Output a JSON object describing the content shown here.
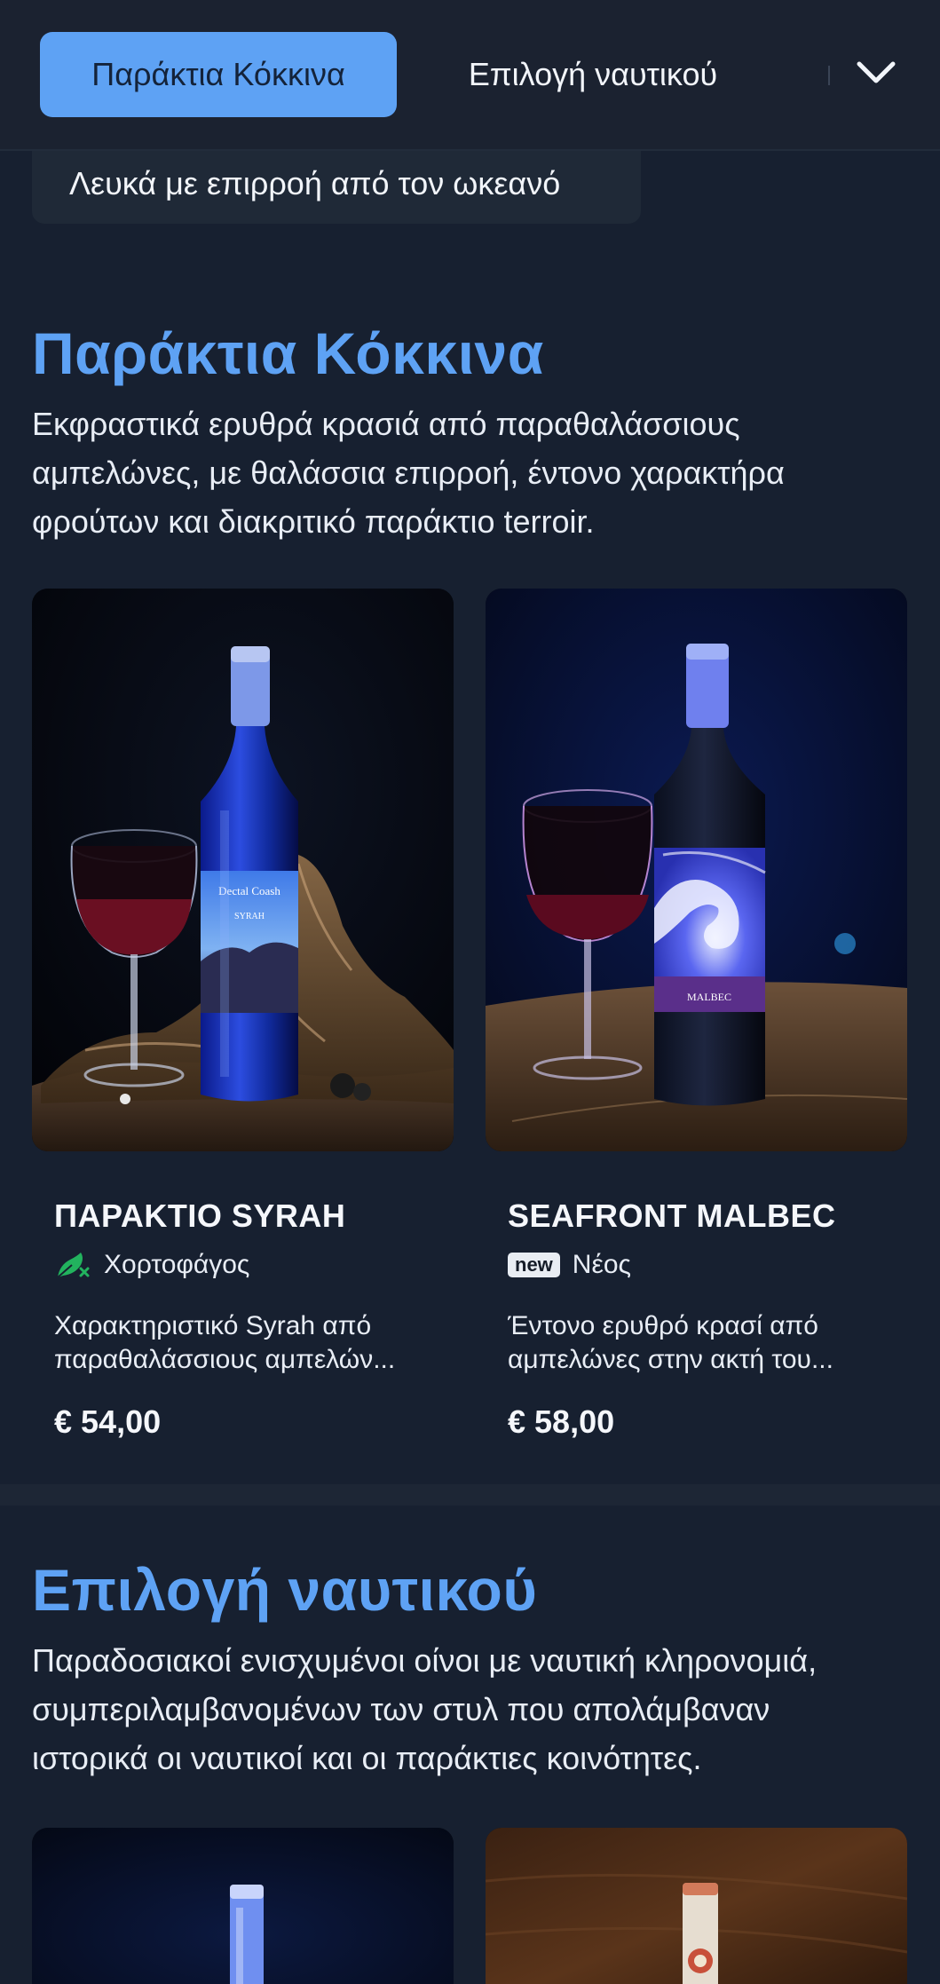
{
  "topbar": {
    "active_tab": "Παράκτια Κόκκινα",
    "tab_2": "Επιλογή ναυτικού"
  },
  "pills": {
    "white_wines": "Λευκά με επιρροή από τον ωκεανό"
  },
  "sections": [
    {
      "title": "Παράκτια Κόκκινα",
      "description_lines": [
        "Εκφραστικά ερυθρά κρασιά από παραθαλάσσιους",
        "αμπελώνες, με θαλάσσια επιρροή, έντονο χαρακτήρα",
        "φρούτων και διακριτικό παράκτιο terroir."
      ],
      "products": [
        {
          "name": "ΠΑΡΑΚΤΙΟ SYRAH",
          "badge_icon": "vegetarian-icon",
          "badge_label": "Χορτοφάγος",
          "desc_line1": "Χαρακτηριστικό Syrah από",
          "desc_line2": "παραθαλάσσιους αμπελών...",
          "price": "€ 54,00",
          "label_text_1": "Dectal Coash",
          "label_text_2": "SYRAH"
        },
        {
          "name": "SEAFRONT MALBEC",
          "badge_tag": "new",
          "badge_label": "Νέος",
          "desc_line1": "Έντονο ερυθρό κρασί από",
          "desc_line2": "αμπελώνες στην ακτή του...",
          "price": "€ 58,00",
          "label_text_1": "MALBEC"
        }
      ]
    },
    {
      "title": "Επιλογή ναυτικού",
      "description_lines": [
        "Παραδοσιακοί ενισχυμένοι οίνοι με ναυτική κληρονομιά,",
        "συμπεριλαμβανομένων των στυλ που απολάμβαναν",
        "ιστορικά οι ναυτικοί και οι παράκτιες κοινότητες."
      ]
    }
  ],
  "colors": {
    "accent": "#5ea2f4",
    "background": "#172030",
    "topbar": "#1b2230",
    "vegetarian_green": "#22b35e"
  }
}
